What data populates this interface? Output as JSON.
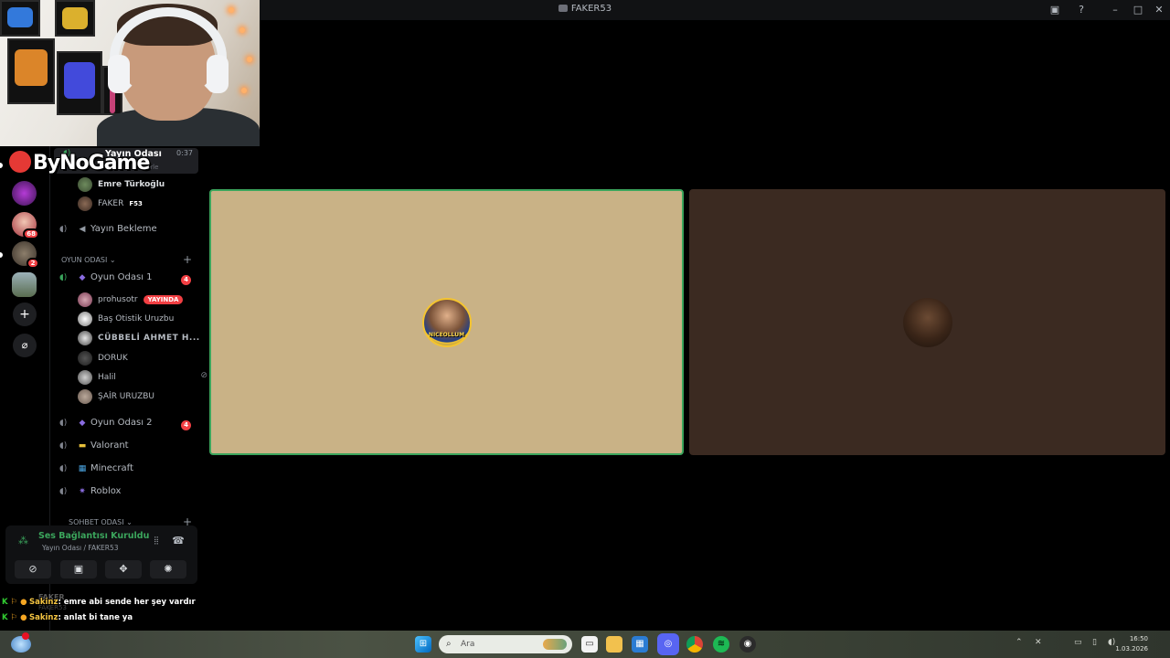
{
  "window": {
    "title": "FAKER53"
  },
  "overlay": {
    "brand": "ByNoGame"
  },
  "rail": {
    "badges": [
      "68",
      "2"
    ],
    "add_label": "+",
    "explore_label": "⌀"
  },
  "header_channel": {
    "name": "Yayın Odası",
    "time": "0:37",
    "sub": "u belirle"
  },
  "channels": {
    "yayin_users": [
      {
        "name": "Emre Türkoğlu"
      },
      {
        "name": "FAKER",
        "tag": "F53"
      }
    ],
    "yayin_bekleme": "Yayın Bekleme",
    "category": "OYUN ODASI",
    "oyun1": {
      "name": "Oyun Odası 1",
      "badge": "4"
    },
    "oyun1_users": [
      {
        "name": "prohusotr",
        "live": "YAYINDA"
      },
      {
        "name": "Baş Otistik Uruzbu"
      },
      {
        "name": "CÜBBELİ AHMET H..."
      },
      {
        "name": "DORUK"
      },
      {
        "name": "Halil"
      },
      {
        "name": "ŞAİR URUZBU"
      }
    ],
    "oyun2": {
      "name": "Oyun Odası 2",
      "badge": "4"
    },
    "valorant": "Valorant",
    "minecraft": "Minecraft",
    "roblox": "Roblox",
    "category2": "SOHBET ODASI"
  },
  "voice": {
    "status": "Ses Bağlantısı Kuruldu",
    "location": "Yayın Odası / FAKER53"
  },
  "user_panel": {
    "name": "FAKER",
    "sub": "FAKER53"
  },
  "chat": [
    {
      "user": "Sakinz",
      "message": ": emre abi sende her şey vardır"
    },
    {
      "user": "Sakinz",
      "message": ": anlat bi tane ya"
    }
  ],
  "tiles": [
    {
      "avatar_text": "NICEOLLUM"
    },
    {
      "avatar_text": ""
    }
  ],
  "taskbar": {
    "search_placeholder": "Ara",
    "time": "16:50",
    "date": "1.03.2026"
  },
  "colors": {
    "accent_green": "#3ba55c",
    "badge_red": "#f23f43",
    "tile_1_bg": "#c9b286",
    "tile_2_bg": "#3b2a21"
  }
}
